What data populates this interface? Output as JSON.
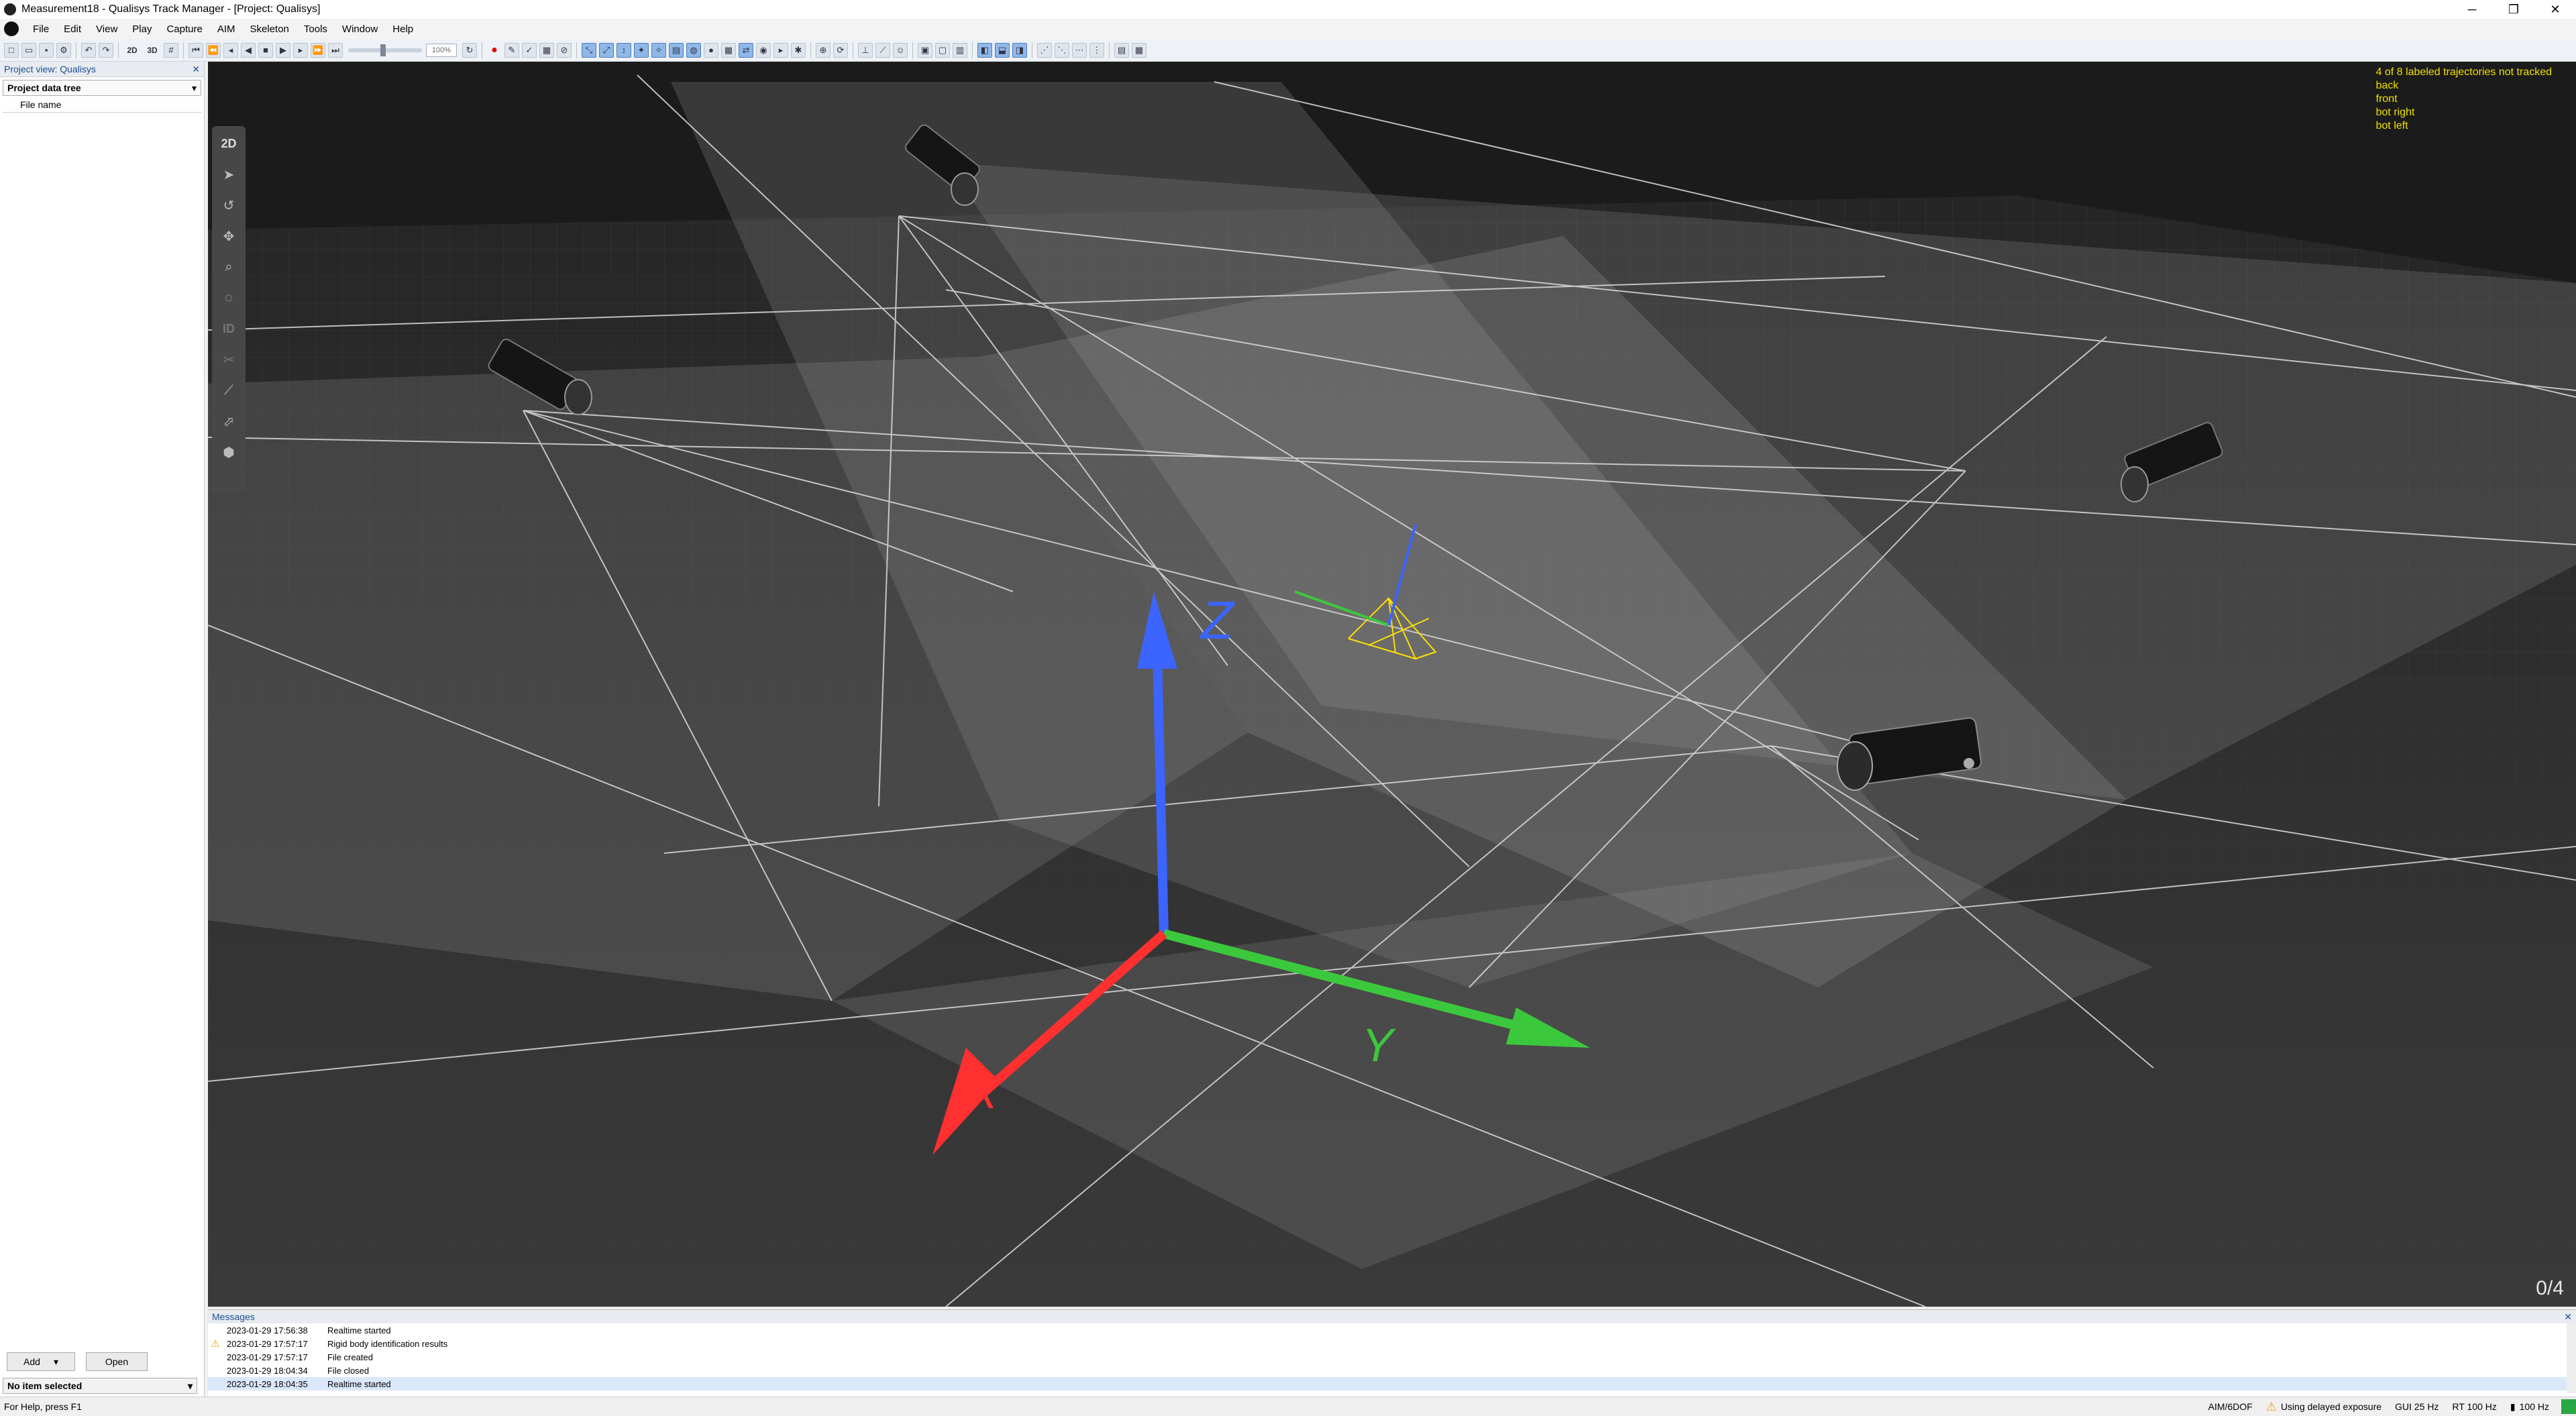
{
  "window": {
    "title": "Measurement18 - Qualisys Track Manager - [Project: Qualisys]",
    "minimize": "─",
    "restore": "❐",
    "close": "✕"
  },
  "menu": [
    "File",
    "Edit",
    "View",
    "Play",
    "Capture",
    "AIM",
    "Skeleton",
    "Tools",
    "Window",
    "Help"
  ],
  "toolbar": {
    "view_2d": "2D",
    "view_3d": "3D",
    "speed_value": "100%"
  },
  "left_panel": {
    "title": "Project view: Qualisys",
    "close": "✕",
    "dropdown_label": "Project data tree",
    "dropdown_arrow": "▾",
    "column_header": "File name",
    "add_button": "Add",
    "add_arrow": "▾",
    "open_button": "Open",
    "selection_label": "No item selected",
    "selection_arrow": "▾"
  },
  "viewport": {
    "tool_2d": "2D",
    "tool_id": "ID",
    "trajectory_status": "4 of 8 labeled trajectories not tracked",
    "trajectory_labels": [
      "back",
      "front",
      "bot right",
      "bot left"
    ],
    "frame_counter": "0/4",
    "axis_labels": {
      "x": "X",
      "y": "Y",
      "z": "Z"
    },
    "colors": {
      "x_axis": "#ff3030",
      "y_axis": "#3cc83c",
      "z_axis": "#3c64ff",
      "overlay_text": "#f0e000",
      "rigid_body": "#ffe000"
    },
    "icons": [
      "cursor-icon",
      "rotate-icon",
      "move-icon",
      "zoom-icon",
      "orbit-icon",
      "cut-icon",
      "bone-icon",
      "select-icon",
      "cube-icon"
    ]
  },
  "messages": {
    "title": "Messages",
    "close": "✕",
    "rows": [
      {
        "timestamp": "2023-01-29 17:56:38",
        "text": "Realtime started",
        "icon": ""
      },
      {
        "timestamp": "2023-01-29 17:57:17",
        "text": "Rigid body identification results",
        "icon": "warning"
      },
      {
        "timestamp": "2023-01-29 17:57:17",
        "text": "File created",
        "icon": ""
      },
      {
        "timestamp": "2023-01-29 18:04:34",
        "text": "File closed",
        "icon": ""
      },
      {
        "timestamp": "2023-01-29 18:04:35",
        "text": "Realtime started",
        "icon": ""
      }
    ]
  },
  "statusbar": {
    "help": "For Help, press F1",
    "mode": "AIM/6DOF",
    "exposure_warning": "Using delayed exposure",
    "gui_rate": "GUI 25 Hz",
    "rt_rate": "RT 100 Hz",
    "capture_rate": "100 Hz"
  }
}
